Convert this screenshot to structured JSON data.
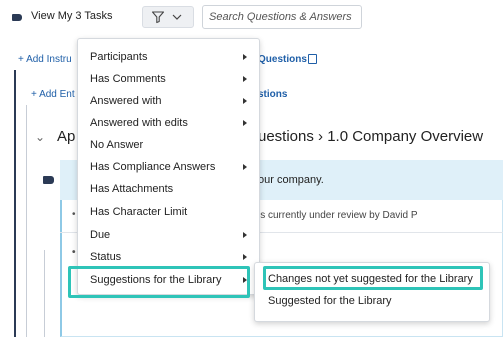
{
  "toolbar": {
    "view_tasks_label": "View My 3 Tasks",
    "search_placeholder": "Search Questions & Answers",
    "filter_icon": "filter-icon",
    "chevron_icon": "chevron-down-icon"
  },
  "background": {
    "add_instructions_label": "+ Add Instru",
    "questions_link": "Questions",
    "add_entry_label": "+ Add Ent",
    "stions_link": "stions",
    "section_prefix": "Ap",
    "breadcrumb": "uestions › 1.0 Company Overview",
    "question_text": "our company.",
    "review_text": "is currently under review by David P"
  },
  "menu": {
    "items": [
      {
        "label": "Participants",
        "has_submenu": true
      },
      {
        "label": "Has Comments",
        "has_submenu": true
      },
      {
        "label": "Answered with",
        "has_submenu": true
      },
      {
        "label": "Answered with edits",
        "has_submenu": true
      },
      {
        "label": "No Answer",
        "has_submenu": false
      },
      {
        "label": "Has Compliance Answers",
        "has_submenu": true
      },
      {
        "label": "Has Attachments",
        "has_submenu": false
      },
      {
        "label": "Has Character Limit",
        "has_submenu": false
      },
      {
        "label": "Due",
        "has_submenu": true
      },
      {
        "label": "Status",
        "has_submenu": true
      },
      {
        "label": "Suggestions for the Library",
        "has_submenu": true
      }
    ]
  },
  "submenu": {
    "items": [
      {
        "label": "Changes not yet suggested for the Library"
      },
      {
        "label": "Suggested for the Library"
      }
    ]
  },
  "colors": {
    "highlight": "#2ec4b8",
    "link": "#1f5fa8",
    "accent_dark": "#2b3a55"
  }
}
